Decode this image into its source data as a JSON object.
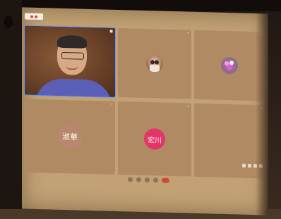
{
  "meeting": {
    "tiles": [
      {
        "type": "video",
        "name": "",
        "active": true
      },
      {
        "type": "photo",
        "name": ""
      },
      {
        "type": "photo",
        "name": ""
      },
      {
        "type": "initials",
        "name": "",
        "avatar_text": "淑華",
        "avatar_color": "#b8876d"
      },
      {
        "type": "initials",
        "name": "",
        "avatar_text": "宏川",
        "avatar_color": "#e4346a"
      },
      {
        "type": "empty",
        "name": ""
      }
    ],
    "toolbar": {
      "buttons": [
        "mic-icon",
        "camera-icon",
        "share-icon",
        "more-icon",
        "leave-icon"
      ]
    }
  },
  "colors": {
    "projection": "#c2a275",
    "tile": "#b08a62",
    "leave": "#cf4a3a",
    "active_border": "#5a9bff"
  }
}
